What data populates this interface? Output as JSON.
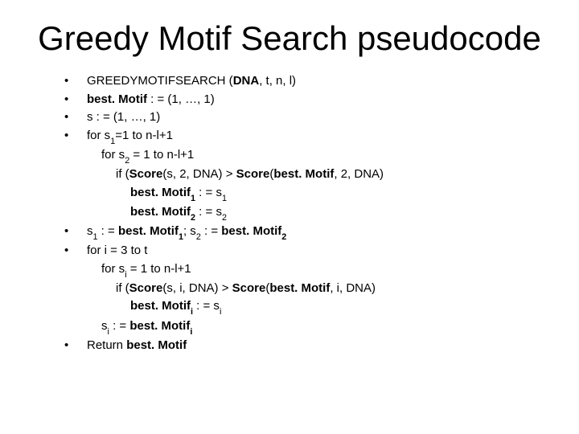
{
  "title": "Greedy Motif Search pseudocode",
  "lines": [
    {
      "bullet": true,
      "indent": 0,
      "segments": [
        {
          "t": "GREEDYMOTIFSEARCH ("
        },
        {
          "t": "DNA",
          "b": true
        },
        {
          "t": ", t, n, l)"
        }
      ]
    },
    {
      "bullet": true,
      "indent": 0,
      "segments": [
        {
          "t": "best. Motif",
          "b": true
        },
        {
          "t": " : = (1, …, 1)"
        }
      ]
    },
    {
      "bullet": true,
      "indent": 0,
      "segments": [
        {
          "t": "s : = (1, …, 1)"
        }
      ]
    },
    {
      "bullet": true,
      "indent": 0,
      "segments": [
        {
          "t": "for s"
        },
        {
          "t": "1",
          "sub": true
        },
        {
          "t": "=1 to n-l+1"
        }
      ]
    },
    {
      "bullet": false,
      "indent": 1,
      "segments": [
        {
          "t": "for s"
        },
        {
          "t": "2",
          "sub": true
        },
        {
          "t": " = 1 to n-l+1"
        }
      ]
    },
    {
      "bullet": false,
      "indent": 2,
      "segments": [
        {
          "t": "if ("
        },
        {
          "t": "Score",
          "b": true
        },
        {
          "t": "(s, 2, DNA) > "
        },
        {
          "t": "Score",
          "b": true
        },
        {
          "t": "("
        },
        {
          "t": "best. Motif",
          "b": true
        },
        {
          "t": ", 2, DNA)"
        }
      ]
    },
    {
      "bullet": false,
      "indent": 3,
      "segments": [
        {
          "t": "best. Motif",
          "b": true
        },
        {
          "t": "1",
          "sub": true,
          "b": true
        },
        {
          "t": " : = s"
        },
        {
          "t": "1",
          "sub": true
        }
      ]
    },
    {
      "bullet": false,
      "indent": 3,
      "segments": [
        {
          "t": "best. Motif",
          "b": true
        },
        {
          "t": "2",
          "sub": true,
          "b": true
        },
        {
          "t": " : = s"
        },
        {
          "t": "2",
          "sub": true
        }
      ]
    },
    {
      "bullet": true,
      "indent": 0,
      "segments": [
        {
          "t": "s"
        },
        {
          "t": "1",
          "sub": true
        },
        {
          "t": " : = "
        },
        {
          "t": "best. Motif",
          "b": true
        },
        {
          "t": "1",
          "sub": true,
          "b": true
        },
        {
          "t": "; s"
        },
        {
          "t": "2",
          "sub": true
        },
        {
          "t": " : = "
        },
        {
          "t": "best. Motif",
          "b": true
        },
        {
          "t": "2",
          "sub": true,
          "b": true
        }
      ]
    },
    {
      "bullet": true,
      "indent": 0,
      "segments": [
        {
          "t": "for i = 3 to t"
        }
      ]
    },
    {
      "bullet": false,
      "indent": 1,
      "segments": [
        {
          "t": "for s"
        },
        {
          "t": "i",
          "sub": true
        },
        {
          "t": " = 1 to n-l+1"
        }
      ]
    },
    {
      "bullet": false,
      "indent": 2,
      "segments": [
        {
          "t": "if ("
        },
        {
          "t": "Score",
          "b": true
        },
        {
          "t": "(s, i, DNA) > "
        },
        {
          "t": "Score",
          "b": true
        },
        {
          "t": "("
        },
        {
          "t": "best. Motif",
          "b": true
        },
        {
          "t": ", i, DNA)"
        }
      ]
    },
    {
      "bullet": false,
      "indent": 3,
      "segments": [
        {
          "t": "best. Motif",
          "b": true
        },
        {
          "t": "i",
          "sub": true,
          "b": true
        },
        {
          "t": " : = s"
        },
        {
          "t": "i",
          "sub": true
        }
      ]
    },
    {
      "bullet": false,
      "indent": 1,
      "segments": [
        {
          "t": "s"
        },
        {
          "t": "i",
          "sub": true
        },
        {
          "t": " : = "
        },
        {
          "t": "best. Motif",
          "b": true
        },
        {
          "t": "i",
          "sub": true,
          "b": true
        }
      ]
    },
    {
      "bullet": true,
      "indent": 0,
      "segments": [
        {
          "t": "Return "
        },
        {
          "t": "best. Motif",
          "b": true
        }
      ]
    }
  ]
}
